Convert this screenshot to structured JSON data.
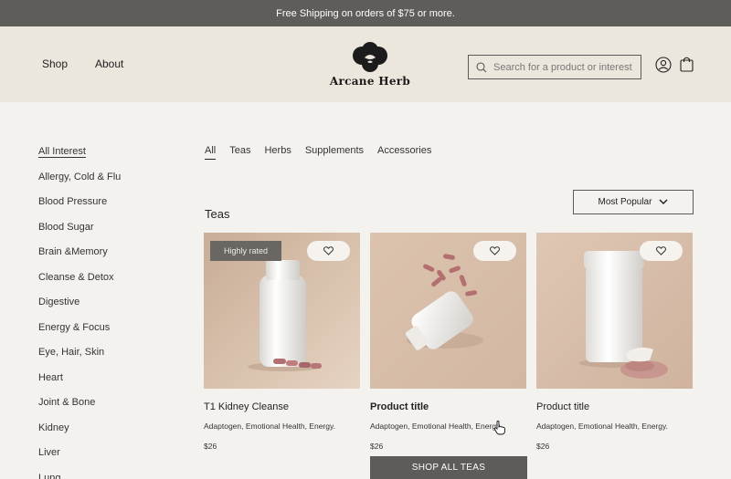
{
  "promo": {
    "text": "Free Shipping on orders of $75 or more."
  },
  "header": {
    "nav": [
      "Shop",
      "About"
    ],
    "brand": "Arcane Herb",
    "search_placeholder": "Search for a product or interest",
    "icons": [
      "user-icon",
      "shopping-bag-icon"
    ]
  },
  "sidebar": {
    "items": [
      "All Interest",
      "Allergy, Cold & Flu",
      "Blood Pressure",
      "Blood Sugar",
      "Brain &Memory",
      "Cleanse & Detox",
      "Digestive",
      "Energy & Focus",
      "Eye, Hair, Skin",
      "Heart",
      "Joint & Bone",
      "Kidney",
      "Liver",
      "Lung"
    ],
    "active": "All Interest"
  },
  "filters": {
    "items": [
      "All",
      "Teas",
      "Herbs",
      "Supplements",
      "Accessories"
    ],
    "active": "All"
  },
  "section": {
    "title": "Teas"
  },
  "sort": {
    "label": "Most Popular"
  },
  "products": [
    {
      "badge": "Highly rated",
      "title": "T1 Kidney Cleanse",
      "tags": "Adaptogen, Emotional Health, Energy.",
      "price": "$26"
    },
    {
      "title": "Product title",
      "tags": "Adaptogen, Emotional Health, Energy.",
      "price": "$26"
    },
    {
      "title": "Product title",
      "tags": "Adaptogen, Emotional Health, Energy.",
      "price": "$26"
    }
  ],
  "cta": {
    "label": "SHOP ALL TEAS"
  },
  "colors": {
    "promo_bg": "#5f5d59",
    "header_bg": "#ece7dc",
    "page_bg": "#f4f2ee",
    "button_bg": "#5e5c58",
    "product_bg": "#dcc9b5"
  }
}
